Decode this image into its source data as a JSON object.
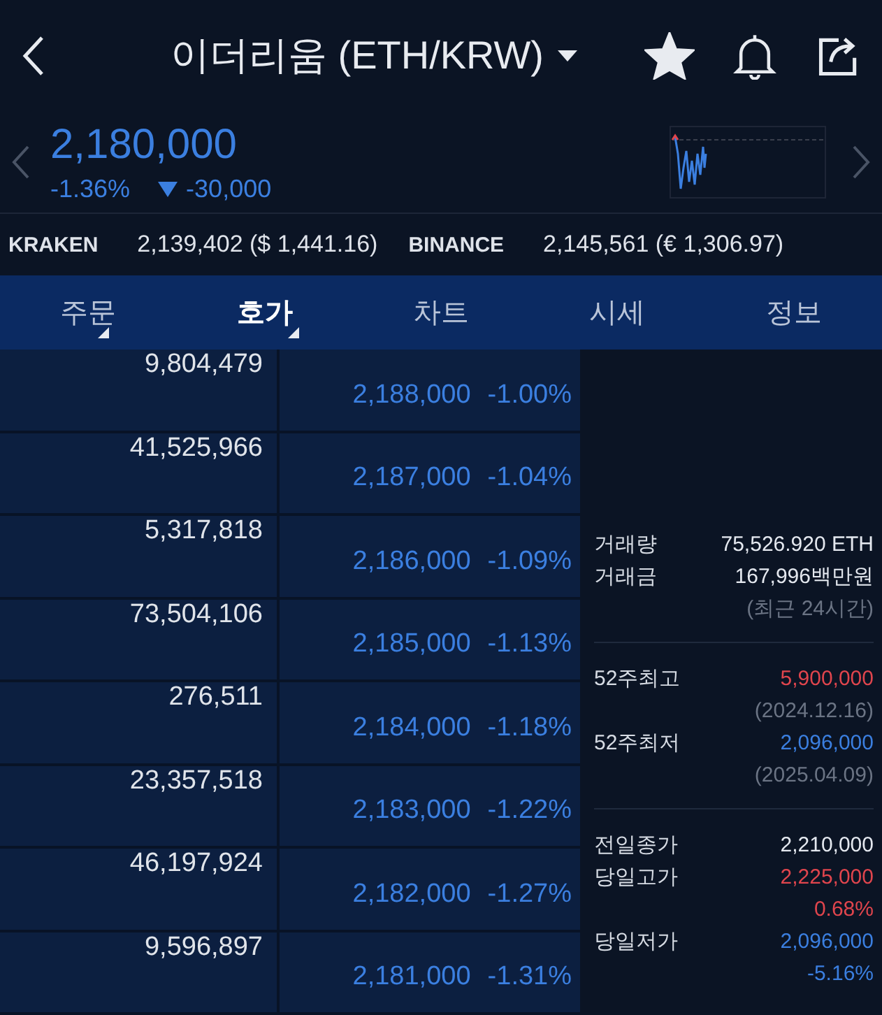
{
  "header": {
    "title": "이더리움 (ETH/KRW)",
    "favorite": true
  },
  "quote": {
    "price": "2,180,000",
    "change_rate": "-1.36%",
    "falling": true,
    "change_amount": "-30,000"
  },
  "exchanges": [
    {
      "name": "KRAKEN",
      "value": "2,139,402 ($ 1,441.16)"
    },
    {
      "name": "BINANCE",
      "value": "2,145,561 (€ 1,306.97)"
    }
  ],
  "tabs": [
    {
      "label": "주문",
      "selected": false,
      "has_menu": true
    },
    {
      "label": "호가",
      "selected": true,
      "has_menu": true
    },
    {
      "label": "차트",
      "selected": false,
      "has_menu": false
    },
    {
      "label": "시세",
      "selected": false,
      "has_menu": false
    },
    {
      "label": "정보",
      "selected": false,
      "has_menu": false
    }
  ],
  "order_book": [
    {
      "volume": "9,804,479",
      "price": "2,188,000",
      "change": "-1.00%"
    },
    {
      "volume": "41,525,966",
      "price": "2,187,000",
      "change": "-1.04%"
    },
    {
      "volume": "5,317,818",
      "price": "2,186,000",
      "change": "-1.09%"
    },
    {
      "volume": "73,504,106",
      "price": "2,185,000",
      "change": "-1.13%"
    },
    {
      "volume": "276,511",
      "price": "2,184,000",
      "change": "-1.18%"
    },
    {
      "volume": "23,357,518",
      "price": "2,183,000",
      "change": "-1.22%"
    },
    {
      "volume": "46,197,924",
      "price": "2,182,000",
      "change": "-1.27%"
    },
    {
      "volume": "9,596,897",
      "price": "2,181,000",
      "change": "-1.31%"
    }
  ],
  "info": [
    {
      "rows": [
        {
          "label": "거래량",
          "value": "75,526.920 ETH",
          "color": "#e4e8ef"
        },
        {
          "label": "거래금",
          "value": "167,996백만원",
          "color": "#e4e8ef"
        },
        {
          "value": "(최근 24시간)",
          "color": "#6b7484"
        }
      ]
    },
    {
      "rows": [
        {
          "label": "52주최고",
          "value": "5,900,000",
          "color": "#e0454d"
        },
        {
          "value": "(2024.12.16)",
          "color": "#6b7484"
        },
        {
          "label": "52주최저",
          "value": "2,096,000",
          "color": "#3b7fe0"
        },
        {
          "value": "(2025.04.09)",
          "color": "#6b7484"
        }
      ]
    },
    {
      "rows": [
        {
          "label": "전일종가",
          "value": "2,210,000",
          "color": "#e4e8ef"
        },
        {
          "label": "당일고가",
          "value": "2,225,000",
          "color": "#e0454d"
        },
        {
          "value": "0.68%",
          "color": "#e0454d"
        },
        {
          "label": "당일저가",
          "value": "2,096,000",
          "color": "#3b7fe0"
        },
        {
          "value": "-5.16%",
          "color": "#3b7fe0"
        }
      ]
    }
  ]
}
